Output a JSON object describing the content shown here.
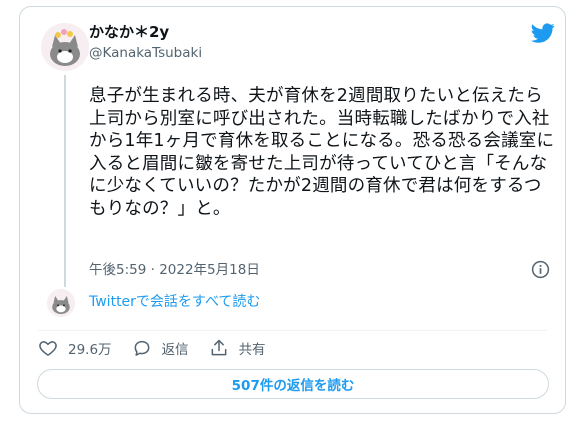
{
  "user": {
    "display_name": "かなか＊2y",
    "handle": "@KanakaTsubaki"
  },
  "tweet": {
    "text": "息子が生まれる時、夫が育休を2週間取りたいと伝えたら上司から別室に呼び出された。当時転職したばかりで入社から1年1ヶ月で育休を取ることになる。恐る恐る会議室に入ると眉間に皺を寄せた上司が待っていてひと言「そんなに少なくていいの？たかが2週間の育休で君は何をするつもりなの？」と。",
    "timestamp": "午後5:59 · 2022年5月18日"
  },
  "thread": {
    "read_all_label": "Twitterで会話をすべて読む"
  },
  "actions": {
    "like_count": "29.6万",
    "reply_label": "返信",
    "share_label": "共有"
  },
  "footer": {
    "read_replies_label": "507件の返信を読む"
  },
  "icons": {
    "brand": "twitter-bird-icon",
    "info": "info-icon",
    "like": "heart-icon",
    "reply": "speech-bubble-icon",
    "share": "upload-icon"
  },
  "colors": {
    "accent": "#1d9bf0",
    "text": "#0f1419",
    "secondary_text": "#536471",
    "border": "#cfd9de"
  }
}
